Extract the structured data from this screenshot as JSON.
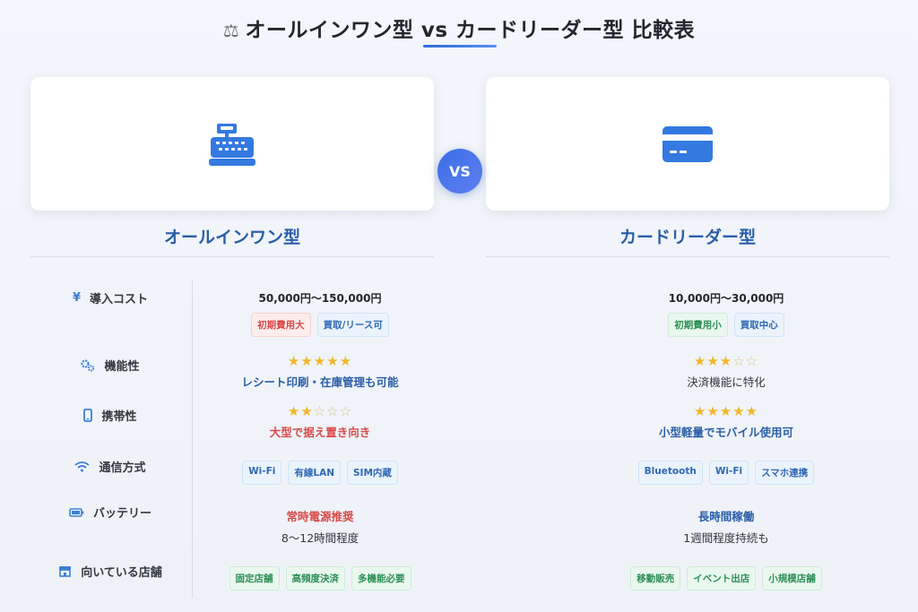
{
  "title": "オールインワン型 vs カードリーダー型 比較表",
  "title_icon": "scale-icon",
  "vs_label": "VS",
  "left": {
    "name": "オールインワン型",
    "icon": "cash-register-icon",
    "cost": "50,000円〜150,000円",
    "cost_tags": [
      {
        "label": "初期費用大",
        "color": "red"
      },
      {
        "label": "買取/リース可",
        "color": "blue"
      }
    ],
    "function_rating": 5,
    "function_text": "レシート印刷・在庫管理も可能",
    "portability_rating": 2,
    "portability_text": "大型で据え置き向き",
    "comm_tags": [
      "Wi-Fi",
      "有線LAN",
      "SIM内蔵"
    ],
    "battery_main": "常時電源推奨",
    "battery_sub": "8〜12時間程度",
    "store_tags": [
      "固定店舗",
      "高頻度決済",
      "多機能必要"
    ]
  },
  "right": {
    "name": "カードリーダー型",
    "icon": "credit-card-icon",
    "cost": "10,000円〜30,000円",
    "cost_tags": [
      {
        "label": "初期費用小",
        "color": "green"
      },
      {
        "label": "買取中心",
        "color": "blue"
      }
    ],
    "function_rating": 3,
    "function_text": "決済機能に特化",
    "portability_rating": 5,
    "portability_text": "小型軽量でモバイル使用可",
    "comm_tags": [
      "Bluetooth",
      "Wi-Fi",
      "スマホ連携"
    ],
    "battery_main": "長時間稼働",
    "battery_sub": "1週間程度持続も",
    "store_tags": [
      "移動販売",
      "イベント出店",
      "小規模店舗"
    ]
  },
  "rows": [
    {
      "label": "導入コスト",
      "icon": "yen-icon"
    },
    {
      "label": "機能性",
      "icon": "gears-icon"
    },
    {
      "label": "携帯性",
      "icon": "smartphone-icon"
    },
    {
      "label": "通信方式",
      "icon": "wifi-icon"
    },
    {
      "label": "バッテリー",
      "icon": "battery-icon"
    },
    {
      "label": "向いている店舗",
      "icon": "store-icon"
    }
  ],
  "colors": {
    "accent": "#2a5ea8",
    "vs_badge": "#3c6ee6",
    "star": "#f3b52a",
    "negative": "#d94b4b",
    "positive": "#2c8f55"
  }
}
